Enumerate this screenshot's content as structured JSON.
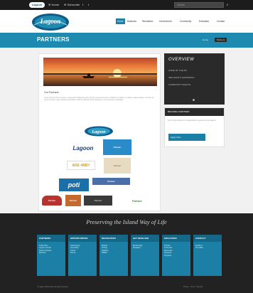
{
  "topbar": {
    "logo_text": "Lagoon",
    "items": [
      "⊕ Home",
      "⊕ Subscribe",
      "f",
      "t"
    ],
    "search_placeholder": "Search",
    "search_icon": "search-icon"
  },
  "header": {
    "logo_text": "Lagoon",
    "nav": [
      "Home",
      "Business",
      "Recreation",
      "Government",
      "Community",
      "Education",
      "Contact"
    ],
    "active_nav": "Home"
  },
  "banner": {
    "title": "PARTNERS",
    "crumb_home": "Home",
    "crumb_current": "Partners"
  },
  "content": {
    "page_title": "Our Partners",
    "paragraph": "Lorem ipsum dolor sit amet, consectetur adipiscing elit, sed do eiusmod tempor incididunt ut labore et dolore magna aliqua. Ut enim ad minim veniam, quis nostrud exercitation ullamco laboris nisi ut aliquip ex ea commodo consequat.",
    "partner_logos": [
      {
        "name": "Lagoon",
        "color": "#0c5b8a"
      },
      {
        "name": "Lagoon",
        "color": "#1b3f7a"
      },
      {
        "name": "Partner",
        "color": "#2a8bc9"
      },
      {
        "name": "ARE 4BBY",
        "color": "#c9a23a"
      },
      {
        "name": "Partner",
        "color": "#e7dcc2"
      },
      {
        "name": "poti",
        "color": "#1b6fa8"
      },
      {
        "name": "Partner",
        "color": "#4a6fa8"
      },
      {
        "name": "Partner",
        "color": "#b8322e"
      },
      {
        "name": "Partner",
        "color": "#c46a2e"
      },
      {
        "name": "Partner",
        "color": "#3a3a3a"
      },
      {
        "name": "Partner",
        "color": "#3d8a3a"
      }
    ]
  },
  "sidebar": {
    "overview_title": "OVERVIEW",
    "overview_lines": [
      "HOME OF THE IRL",
      "SEE WHAT'S HAPPENING",
      "COMMUNITY EVENTS"
    ],
    "box2_title": "BECOME A PARTNER",
    "box2_text": "Join the growing list of organizations supporting the lagoon.",
    "box2_button": "Apply Now"
  },
  "footer": {
    "tagline": "Preserving the Island Way of Life",
    "columns": [
      {
        "title": "PARTNERS",
        "lines": [
          "Indian River",
          "Lagoon Council",
          "Partner Network",
          "Directory"
        ]
      },
      {
        "title": "OPPORTUNITIES",
        "lines": [
          "Volunteering",
          "Internships",
          "Grants",
          "Events"
        ]
      },
      {
        "title": "RECREATION",
        "lines": [
          "Boating",
          "Fishing",
          "Paddling",
          "Wildlife"
        ]
      },
      {
        "title": "GET INVOLVED",
        "lines": [
          "Membership",
          "Donations"
        ]
      },
      {
        "title": "EDUCATION",
        "lines": [
          "Schools",
          "Curriculum",
          "Resources",
          "Research",
          "Programs"
        ]
      },
      {
        "title": "CONTACT",
        "lines": [
          "Email Us",
          "Our Office"
        ]
      }
    ],
    "copyright": "© Lagoon Partnership. All rights reserved.",
    "links": "Privacy  ·  Terms  ·  Sitemap"
  },
  "colors": {
    "accent": "#1e8ab0",
    "dark": "#222222"
  }
}
